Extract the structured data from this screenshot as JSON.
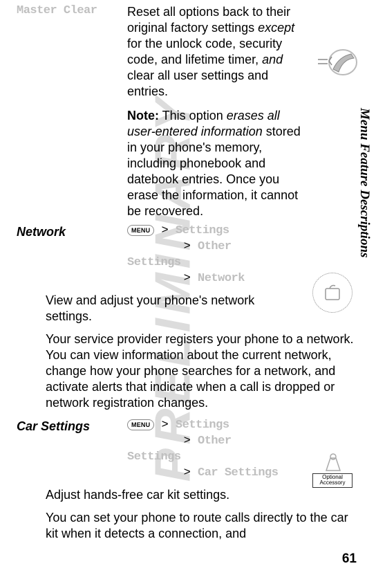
{
  "watermark": "PRELIMINARY",
  "masterClear": {
    "label": "Master Clear",
    "desc_pre": "Reset all options back to their original factory settings ",
    "desc_except": "except",
    "desc_mid": " for the unlock code, security code, and lifetime timer, ",
    "desc_and": "and",
    "desc_post": " clear all user settings and entries.",
    "note_label": "Note:",
    "note_pre": " This option ",
    "note_em": "erases all user-entered information",
    "note_post": " stored in your phone's memory, including phonebook and datebook entries. Once you erase the information, it cannot be recovered."
  },
  "network": {
    "heading": "Network",
    "menu_btn": "MENU",
    "gt": ">",
    "path1": "Settings",
    "path2": "Other Settings",
    "path3": "Network",
    "para1": "View and adjust your phone's network settings.",
    "para2": "Your service provider registers your phone to a network. You can view information about the current network, change how your phone searches for a network, and activate alerts that indicate when a call is dropped or network registration changes."
  },
  "carSettings": {
    "heading": "Car Settings",
    "menu_btn": "MENU",
    "gt": ">",
    "path1": "Settings",
    "path2": "Other Settings",
    "path3": "Car Settings",
    "para1": "Adjust hands-free car kit settings.",
    "para2": "You can set your phone to route calls directly to the car kit when it detects a connection, and"
  },
  "badge_text": "Optional Accessory",
  "sideTab": "Menu Feature Descriptions",
  "pageNum": "61"
}
